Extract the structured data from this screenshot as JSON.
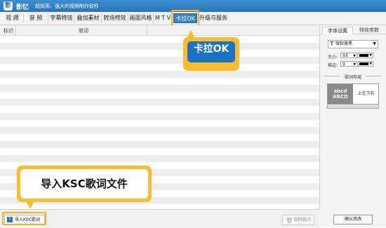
{
  "app": {
    "logo": "影",
    "name": "影忆",
    "tagline": "超简用、强大的视频制作软件"
  },
  "tabs": [
    {
      "label": "视 频"
    },
    {
      "label": "音 频"
    },
    {
      "label": "字幕特效"
    },
    {
      "label": "叠加素材"
    },
    {
      "label": "转场特效"
    },
    {
      "label": "画面风格"
    },
    {
      "label": "M T V"
    },
    {
      "label": "卡拉OK",
      "active": true
    },
    {
      "label": "升级与服务"
    }
  ],
  "table": {
    "col_mark": "标识",
    "col_lyrics": "歌词"
  },
  "bottom": {
    "import_label": "导入KSC歌词",
    "import_icon": "T",
    "delete_label": "删除歌词"
  },
  "side": {
    "tab_font": "字体设置",
    "tab_effect": "特效参数",
    "font_icon": "T",
    "font_name": "微软雅黑",
    "size_label": "大小:",
    "size_value": "93",
    "stroke_label": "描边:",
    "stroke_value": "9",
    "color_hex": "#000000",
    "section_title": "歌词布局",
    "layout_preview_1": "abcd",
    "layout_preview_2": "ABCD",
    "layout_name": "上左下右",
    "confirm_label": "确认修改"
  },
  "callouts": {
    "karaoke": "卡拉OK",
    "import": "导入KSC歌词文件"
  },
  "colors": {
    "accent": "#2a73b9",
    "highlight": "#f5b11f"
  }
}
